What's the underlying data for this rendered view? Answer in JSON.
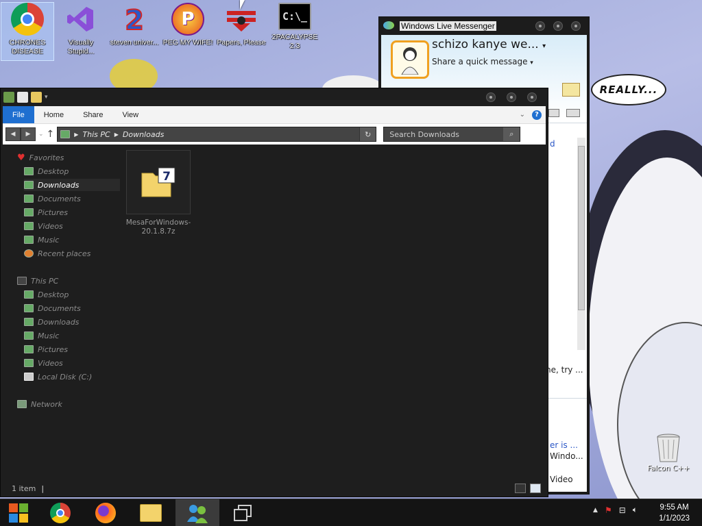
{
  "desktop": {
    "icons": [
      {
        "label": "CHRONES DISEASE",
        "icon": "chrome-icon"
      },
      {
        "label": "Visually Stupid...",
        "icon": "visual-studio-icon"
      },
      {
        "label": "steven univer...",
        "icon": "steven-universe-icon"
      },
      {
        "label": "PEG MY WIFE!",
        "icon": "peg-icon"
      },
      {
        "label": "Papers, Please",
        "icon": "papers-please-icon"
      },
      {
        "label": "2PACALYPSE 2.3",
        "icon": "terminal-icon"
      }
    ],
    "speech_bubble": "REALLY...",
    "recycle_bin_label": "Falcon C++"
  },
  "messenger": {
    "title": "Windows Live Messenger",
    "display_name": "schizo kanye we...",
    "status_placeholder": "Share a quick message",
    "snippet_d": "d",
    "snippet_try": "ne, try ...",
    "snippet_is": "er is ...",
    "snippet_windo": "Windo...",
    "snippet_video": "Video"
  },
  "explorer": {
    "ribbon_tabs": [
      "File",
      "Home",
      "Share",
      "View"
    ],
    "breadcrumb": [
      "This PC",
      "Downloads"
    ],
    "search_placeholder": "Search Downloads",
    "nav": {
      "favorites": "Favorites",
      "fav_items": [
        "Desktop",
        "Downloads",
        "Documents",
        "Pictures",
        "Videos",
        "Music",
        "Recent places"
      ],
      "this_pc": "This PC",
      "pc_items": [
        "Desktop",
        "Documents",
        "Downloads",
        "Music",
        "Pictures",
        "Videos",
        "Local Disk (C:)"
      ],
      "network": "Network"
    },
    "files": [
      {
        "name": "MesaForWindows-20.1.8.7z",
        "icon": "7zip-archive-icon"
      }
    ],
    "status": "1 item"
  },
  "taskbar": {
    "items": [
      "start-orb",
      "chrome",
      "firefox",
      "file-explorer",
      "messenger",
      "task-view"
    ],
    "time": "9:55 AM",
    "date": "1/1/2023"
  },
  "colors": {
    "accent": "#1f6fd0",
    "explorer_bg": "#1e1e1e",
    "taskbar_bg": "#141414"
  }
}
